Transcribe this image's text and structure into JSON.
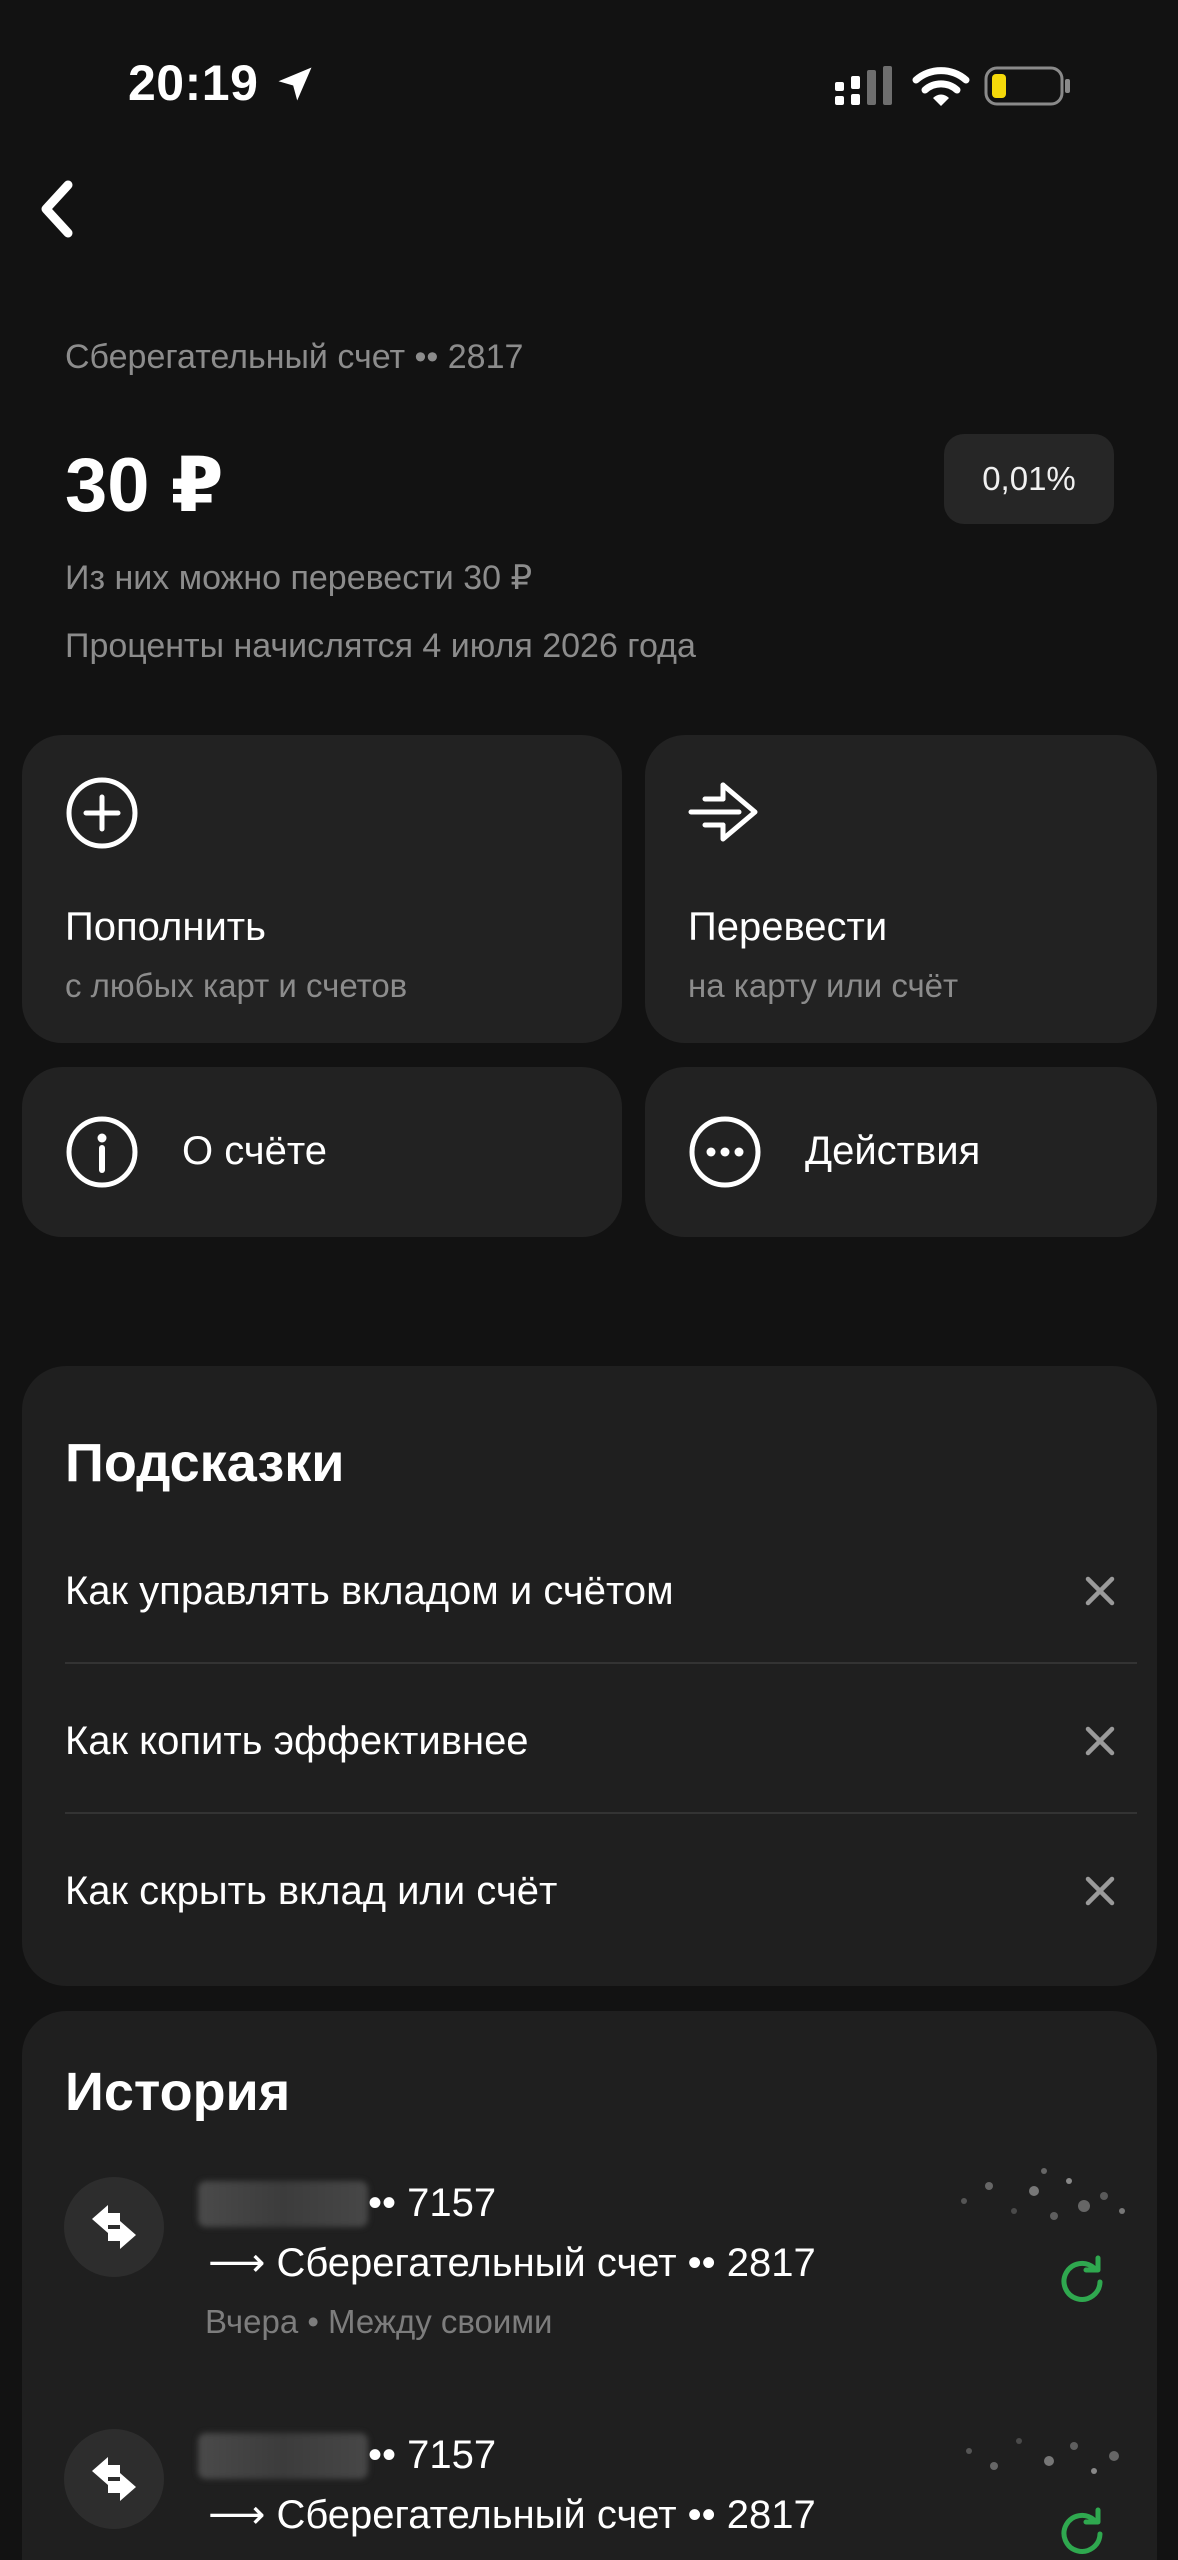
{
  "status_bar": {
    "time": "20:19"
  },
  "account": {
    "label": "Сберегательный счет •• 2817",
    "balance": "30 ₽",
    "rate": "0,01%",
    "transferable": "Из них можно перевести 30 ₽",
    "interest_note": "Проценты начислятся 4 июля 2026 года"
  },
  "tiles": {
    "topup": {
      "title": "Пополнить",
      "subtitle": "с любых карт и счетов",
      "icon": "plus-circle-icon"
    },
    "transfer": {
      "title": "Перевести",
      "subtitle": "на карту или счёт",
      "icon": "send-arrow-icon"
    },
    "about": {
      "title": "О счёте",
      "icon": "info-circle-icon"
    },
    "actions": {
      "title": "Действия",
      "icon": "more-circle-icon"
    }
  },
  "hints": {
    "title": "Подсказки",
    "items": [
      {
        "label": "Как управлять вкладом и счётом"
      },
      {
        "label": "Как копить эффективнее"
      },
      {
        "label": "Как скрыть вклад или счёт"
      }
    ]
  },
  "history": {
    "title": "История",
    "items": [
      {
        "from": "•• 7157",
        "to": "⟶ Сберегательный счет •• 2817",
        "meta": "Вчера • Между своими"
      },
      {
        "from": "•• 7157",
        "to": "⟶ Сберегательный счет •• 2817",
        "meta": ""
      }
    ]
  },
  "colors": {
    "background": "#121212",
    "tile": "#222222",
    "accent_green": "#2fa84f",
    "battery_yellow": "#f5d90a"
  }
}
